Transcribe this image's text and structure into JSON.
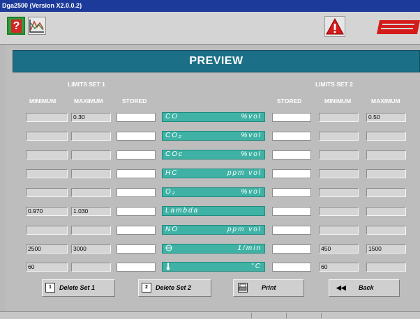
{
  "window": {
    "title": "Dga2500 (Version X2.0.0.2)"
  },
  "toolbar": {
    "help_icon": "help-question-icon",
    "graph_icon": "graph-icon",
    "warning_icon": "warning-triangle-icon",
    "logo_icon": "sun-logo-icon"
  },
  "header": {
    "title": "PREVIEW"
  },
  "limits_set_1": {
    "title": "LIMITS SET 1",
    "col_min": "MINIMUM",
    "col_max": "MAXIMUM",
    "col_stored": "STORED"
  },
  "limits_set_2": {
    "title": "LIMITS SET 2",
    "col_stored": "STORED",
    "col_min": "MINIMUM",
    "col_max": "MAXIMUM"
  },
  "rows": [
    {
      "label": "CO",
      "unit": "%vol",
      "set1_min": "",
      "set1_max": "0.30",
      "set1_stored": "",
      "set2_stored": "",
      "set2_min": "",
      "set2_max": "0.50"
    },
    {
      "label": "CO₂",
      "unit": "%vol",
      "set1_min": "",
      "set1_max": "",
      "set1_stored": "",
      "set2_stored": "",
      "set2_min": "",
      "set2_max": ""
    },
    {
      "label": "COc",
      "unit": "%vol",
      "set1_min": "",
      "set1_max": "",
      "set1_stored": "",
      "set2_stored": "",
      "set2_min": "",
      "set2_max": ""
    },
    {
      "label": "HC",
      "unit": "ppm vol",
      "set1_min": "",
      "set1_max": "",
      "set1_stored": "",
      "set2_stored": "",
      "set2_min": "",
      "set2_max": ""
    },
    {
      "label": "O₂",
      "unit": "%vol",
      "set1_min": "",
      "set1_max": "",
      "set1_stored": "",
      "set2_stored": "",
      "set2_min": "",
      "set2_max": ""
    },
    {
      "label": "Lambda",
      "unit": "",
      "set1_min": "0.970",
      "set1_max": "1.030",
      "set1_stored": "",
      "set2_stored": "",
      "set2_min": "",
      "set2_max": ""
    },
    {
      "label": "NO",
      "unit": "ppm vol",
      "set1_min": "",
      "set1_max": "",
      "set1_stored": "",
      "set2_stored": "",
      "set2_min": "",
      "set2_max": ""
    },
    {
      "label": "",
      "unit": "1/min",
      "icon": "engine-speed-icon",
      "set1_min": "2500",
      "set1_max": "3000",
      "set1_stored": "",
      "set2_stored": "",
      "set2_min": "450",
      "set2_max": "1500"
    },
    {
      "label": "",
      "unit": "°C",
      "icon": "thermometer-icon",
      "set1_min": "60",
      "set1_max": "",
      "set1_stored": "",
      "set2_stored": "",
      "set2_min": "60",
      "set2_max": ""
    }
  ],
  "buttons": {
    "delete_set_1": "Delete Set 1",
    "delete_set_2": "Delete Set 2",
    "print": "Print",
    "back": "Back",
    "delete_set_1_icon": "1",
    "delete_set_2_icon": "2",
    "back_icon": "◀◀"
  },
  "colors": {
    "header_bg": "#1b6f87",
    "row_label_bg": "#3fb2a5",
    "panel_bg": "#bdbdbd",
    "titlebar_bg": "#1c3a9a"
  }
}
